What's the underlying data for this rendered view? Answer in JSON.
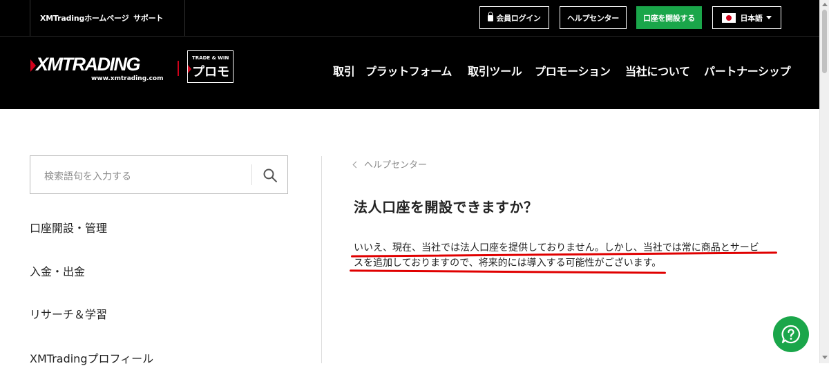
{
  "topbar": {
    "homepage_link": "XMTradingホームページ",
    "support_link": "サポート",
    "login_label": "会員ログイン",
    "help_center_label": "ヘルプセンター",
    "open_account_label": "口座を開設する",
    "language_label": "日本語"
  },
  "header": {
    "logo_text": "XMTRADING",
    "logo_url": "www.xmtrading.com",
    "promo_small": "TRADE & WIN",
    "promo_main": "プロモ",
    "nav": [
      "取引",
      "プラットフォーム",
      "取引ツール",
      "プロモーション",
      "当社について",
      "パートナーシップ"
    ]
  },
  "sidebar": {
    "search_placeholder": "検索語句を入力する",
    "items": [
      "口座開設・管理",
      "入金・出金",
      "リサーチ＆学習",
      "XMTradingプロフィール"
    ]
  },
  "article": {
    "breadcrumb": "ヘルプセンター",
    "title": "法人口座を開設できますか？",
    "body_line1": "いいえ、現在、当社では法人口座を提供しておりません。しかし、当社では常に商品とサービ",
    "body_line2": "スを追加しておりますので、将来的には導入する可能性がございます。"
  },
  "colors": {
    "header_bg": "#000000",
    "accent_green": "#1aa64a",
    "brand_red": "#d0021b",
    "annotation_red": "#e00000"
  }
}
